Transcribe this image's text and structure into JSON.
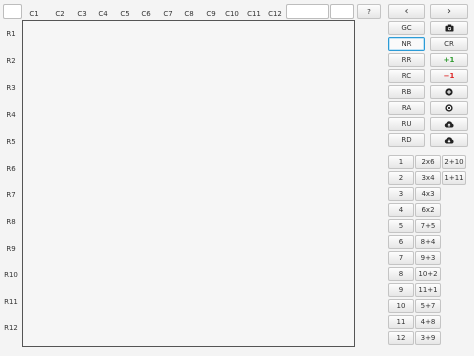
{
  "header": {
    "field1_value": "",
    "field2_value": "",
    "field3_value": "",
    "help_label": "?"
  },
  "columns": [
    "C1",
    "C2",
    "C3",
    "C4",
    "C5",
    "C6",
    "C7",
    "C8",
    "C9",
    "C10",
    "C11",
    "C12"
  ],
  "rows": [
    "R1",
    "R2",
    "R3",
    "R4",
    "R5",
    "R6",
    "R7",
    "R8",
    "R9",
    "R10",
    "R11",
    "R12"
  ],
  "nav": {
    "prev_label": "‹",
    "next_label": "›"
  },
  "left_tools": [
    "GC",
    "NR",
    "RR",
    "RC",
    "RB",
    "RA",
    "RU",
    "RD"
  ],
  "right_tools": {
    "cr_label": "CR",
    "plus_one": "+1",
    "minus_one": "−1"
  },
  "icons": [
    "camera-icon",
    "zoom-in-icon",
    "zoom-out-icon",
    "cloud-upload-icon",
    "cloud-download-icon"
  ],
  "numbers": [
    "1",
    "2",
    "3",
    "4",
    "5",
    "6",
    "7",
    "8",
    "9",
    "10",
    "11",
    "12"
  ],
  "expressions": [
    "2x6",
    "3x4",
    "4x3",
    "6x2",
    "7+5",
    "8+4",
    "9+3",
    "10+2",
    "11+1",
    "5+7",
    "4+8",
    "3+9"
  ],
  "extra_expressions": [
    "2+10",
    "1+11"
  ],
  "colors": {
    "selected_border": "#2c9bd6",
    "plus": "#2e9a2e",
    "minus": "#d22222"
  }
}
